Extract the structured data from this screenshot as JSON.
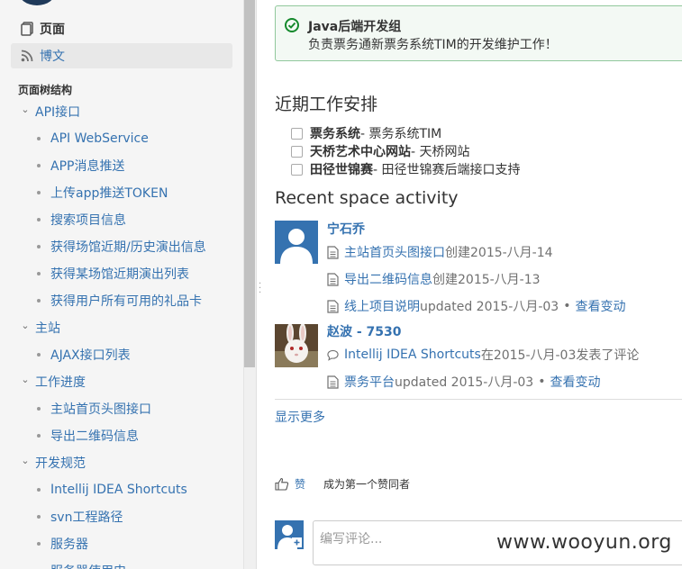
{
  "sidebar": {
    "nav": {
      "pages": "页面",
      "blog": "博文"
    },
    "tree_title": "页面树结构",
    "tree": [
      {
        "label": "API接口",
        "type": "parent"
      },
      {
        "label": "API WebService",
        "type": "child"
      },
      {
        "label": "APP消息推送",
        "type": "child"
      },
      {
        "label": "上传app推送TOKEN",
        "type": "child"
      },
      {
        "label": "搜索项目信息",
        "type": "child"
      },
      {
        "label": "获得场馆近期/历史演出信息",
        "type": "child"
      },
      {
        "label": "获得某场馆近期演出列表",
        "type": "child"
      },
      {
        "label": "获得用户所有可用的礼品卡",
        "type": "child"
      },
      {
        "label": "主站",
        "type": "parent"
      },
      {
        "label": "AJAX接口列表",
        "type": "child"
      },
      {
        "label": "工作进度",
        "type": "parent"
      },
      {
        "label": "主站首页头图接口",
        "type": "child"
      },
      {
        "label": "导出二维码信息",
        "type": "child"
      },
      {
        "label": "开发规范",
        "type": "parent"
      },
      {
        "label": "Intellij IDEA Shortcuts",
        "type": "child"
      },
      {
        "label": "svn工程路径",
        "type": "child"
      },
      {
        "label": "服务器",
        "type": "child"
      },
      {
        "label": "服务器使用申",
        "type": "child"
      }
    ]
  },
  "panel": {
    "title": "Java后端开发组",
    "body": "负责票务通新票务系统TIM的开发维护工作！"
  },
  "schedule": {
    "heading": "近期工作安排",
    "tasks": [
      {
        "name": "票务系统",
        "desc": " - 票务系统TIM"
      },
      {
        "name": "天桥艺术中心网站",
        "desc": " - 天桥网站"
      },
      {
        "name": "田径世锦赛",
        "desc": " - 田径世锦赛后端接口支持"
      }
    ]
  },
  "activity": {
    "heading": "Recent space activity",
    "users": [
      {
        "name": "宁石乔",
        "items": [
          {
            "link": "主站首页头图接口",
            "text": " 创建2015-八月-14",
            "view": ""
          },
          {
            "link": "导出二维码信息",
            "text": " 创建2015-八月-13",
            "view": ""
          },
          {
            "link": "线上项目说明",
            "text": " updated 2015-八月-03",
            "view": "查看变动"
          }
        ]
      },
      {
        "name": "赵波 - 7530",
        "items": [
          {
            "link": "Intellij IDEA Shortcuts",
            "text": " 在2015-八月-03发表了评论",
            "view": ""
          },
          {
            "link": "票务平台",
            "text": " updated 2015-八月-03",
            "view": "查看变动"
          }
        ]
      }
    ],
    "show_more": "显示更多"
  },
  "like": {
    "label": "赞",
    "desc": "成为第一个赞同者"
  },
  "comment": {
    "placeholder": "编写评论..."
  },
  "watermark": "www.wooyun.org",
  "colors": {
    "link": "#3572b0",
    "panel_border": "#91c89c",
    "panel_bg": "#f3f9f4",
    "success": "#14892c"
  }
}
